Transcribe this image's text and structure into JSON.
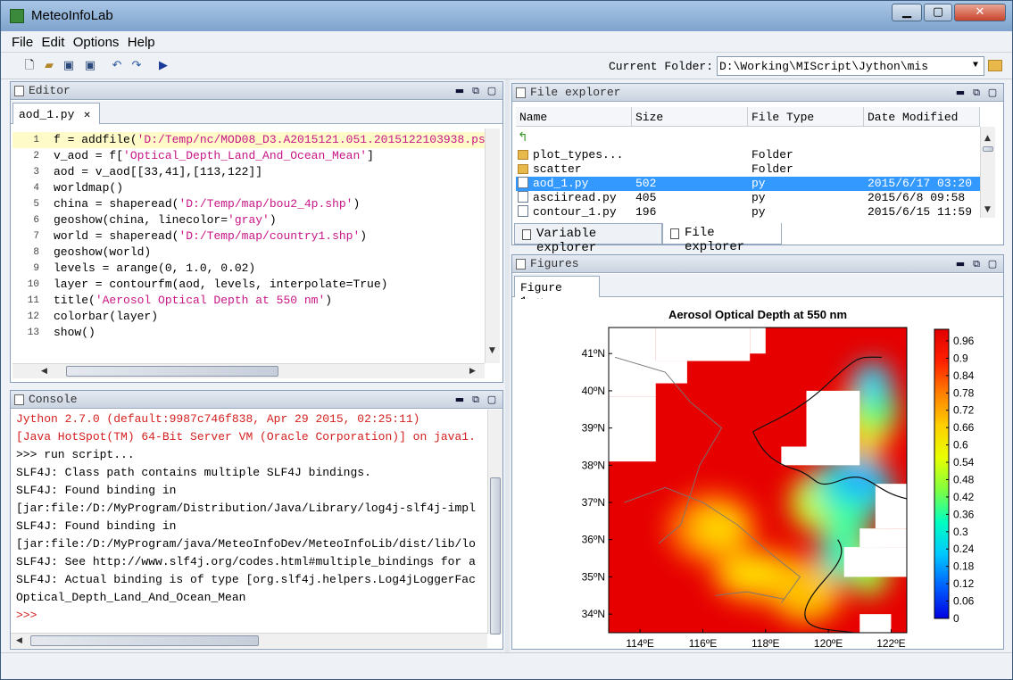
{
  "window": {
    "title": "MeteoInfoLab",
    "minimize": "▁",
    "maximize": "▢",
    "close": "✕"
  },
  "menu": [
    "File",
    "Edit",
    "Options",
    "Help"
  ],
  "toolbar": {
    "icons": [
      "new-file-icon",
      "open-folder-icon",
      "save-icon",
      "save-all-icon",
      "undo-icon",
      "redo-icon",
      "run-icon"
    ],
    "current_folder_label": "Current Folder:",
    "current_folder_value": "D:\\Working\\MIScript\\Jython\\mis"
  },
  "editor": {
    "title": "Editor",
    "tab": "aod_1.py",
    "lines": [
      {
        "n": "1",
        "parts": [
          {
            "t": "f = addfile("
          },
          {
            "t": "'D:/Temp/nc/MOD08_D3.A2015121.051.2015122103938.ps",
            "s": 1
          }
        ]
      },
      {
        "n": "2",
        "parts": [
          {
            "t": "v_aod = f["
          },
          {
            "t": "'Optical_Depth_Land_And_Ocean_Mean'",
            "s": 1
          },
          {
            "t": "]"
          }
        ]
      },
      {
        "n": "3",
        "parts": [
          {
            "t": "aod = v_aod[[33,41],[113,122]]"
          }
        ]
      },
      {
        "n": "4",
        "parts": [
          {
            "t": "worldmap()"
          }
        ]
      },
      {
        "n": "5",
        "parts": [
          {
            "t": "china = shaperead("
          },
          {
            "t": "'D:/Temp/map/bou2_4p.shp'",
            "s": 1
          },
          {
            "t": ")"
          }
        ]
      },
      {
        "n": "6",
        "parts": [
          {
            "t": "geoshow(china, linecolor="
          },
          {
            "t": "'gray'",
            "s": 1
          },
          {
            "t": ")"
          }
        ]
      },
      {
        "n": "7",
        "parts": [
          {
            "t": "world = shaperead("
          },
          {
            "t": "'D:/Temp/map/country1.shp'",
            "s": 1
          },
          {
            "t": ")"
          }
        ]
      },
      {
        "n": "8",
        "parts": [
          {
            "t": "geoshow(world)"
          }
        ]
      },
      {
        "n": "9",
        "parts": [
          {
            "t": "levels = arange(0, 1.0, 0.02)"
          }
        ]
      },
      {
        "n": "10",
        "parts": [
          {
            "t": "layer = contourfm(aod, levels, interpolate=True)"
          }
        ]
      },
      {
        "n": "11",
        "parts": [
          {
            "t": "title("
          },
          {
            "t": "'Aerosol Optical Depth at 550 nm'",
            "s": 1
          },
          {
            "t": ")"
          }
        ]
      },
      {
        "n": "12",
        "parts": [
          {
            "t": "colorbar(layer)"
          }
        ]
      },
      {
        "n": "13",
        "parts": [
          {
            "t": "show()"
          }
        ]
      }
    ]
  },
  "console": {
    "title": "Console",
    "lines": [
      {
        "t": "Jython 2.7.0 (default:9987c746f838, Apr 29 2015, 02:25:11)",
        "red": true
      },
      {
        "t": "[Java HotSpot(TM) 64-Bit Server VM (Oracle Corporation)] on java1.",
        "red": true
      },
      {
        "t": ">>> run script...",
        "red": false
      },
      {
        "t": "SLF4J: Class path contains multiple SLF4J bindings.",
        "red": false
      },
      {
        "t": "SLF4J: Found binding in",
        "red": false
      },
      {
        "t": "[jar:file:/D:/MyProgram/Distribution/Java/Library/log4j-slf4j-impl",
        "red": false
      },
      {
        "t": "SLF4J: Found binding in",
        "red": false
      },
      {
        "t": "[jar:file:/D:/MyProgram/java/MeteoInfoDev/MeteoInfoLib/dist/lib/lo",
        "red": false
      },
      {
        "t": "SLF4J: See http://www.slf4j.org/codes.html#multiple_bindings for a",
        "red": false
      },
      {
        "t": "SLF4J: Actual binding is of type [org.slf4j.helpers.Log4jLoggerFac",
        "red": false
      },
      {
        "t": "Optical_Depth_Land_And_Ocean_Mean",
        "red": false
      },
      {
        "t": ">>>",
        "red": true
      }
    ]
  },
  "file_explorer": {
    "title": "File explorer",
    "columns": [
      "Name",
      "Size",
      "File Type",
      "Date Modified"
    ],
    "rows": [
      {
        "name": "plot_types...",
        "size": "",
        "type": "Folder",
        "date": "",
        "kind": "folder",
        "selected": false
      },
      {
        "name": "scatter",
        "size": "",
        "type": "Folder",
        "date": "",
        "kind": "folder",
        "selected": false
      },
      {
        "name": "aod_1.py",
        "size": "502",
        "type": "py",
        "date": "2015/6/17 03:20",
        "kind": "file",
        "selected": true
      },
      {
        "name": "asciiread.py",
        "size": "405",
        "type": "py",
        "date": "2015/6/8 09:58",
        "kind": "file",
        "selected": false
      },
      {
        "name": "contour_1.py",
        "size": "196",
        "type": "py",
        "date": "2015/6/15 11:59",
        "kind": "file",
        "selected": false
      }
    ],
    "bottom_tabs": [
      "Variable explorer",
      "File explorer"
    ]
  },
  "figures": {
    "title": "Figures",
    "tab": "Figure 1"
  },
  "chart_data": {
    "type": "heatmap",
    "title": "Aerosol Optical Depth at 550 nm",
    "xlabel": "",
    "ylabel": "",
    "x_ticks": [
      "114ºE",
      "116ºE",
      "118ºE",
      "120ºE",
      "122ºE"
    ],
    "y_ticks": [
      "41ºN",
      "40ºN",
      "39ºN",
      "38ºN",
      "37ºN",
      "36ºN",
      "35ºN",
      "34ºN"
    ],
    "xlim": [
      113,
      122.5
    ],
    "ylim": [
      33.5,
      41.7
    ],
    "colorbar_ticks": [
      "0.96",
      "0.9",
      "0.84",
      "0.78",
      "0.72",
      "0.66",
      "0.6",
      "0.54",
      "0.48",
      "0.42",
      "0.36",
      "0.3",
      "0.24",
      "0.18",
      "0.12",
      "0.06",
      "0"
    ],
    "colorbar_range": [
      0,
      1.0
    ],
    "colormap": [
      "#0000e0",
      "#0060ff",
      "#00c8ff",
      "#00ffc0",
      "#80ff40",
      "#e8ff00",
      "#ffd000",
      "#ff8000",
      "#ff2000",
      "#e00000"
    ]
  }
}
